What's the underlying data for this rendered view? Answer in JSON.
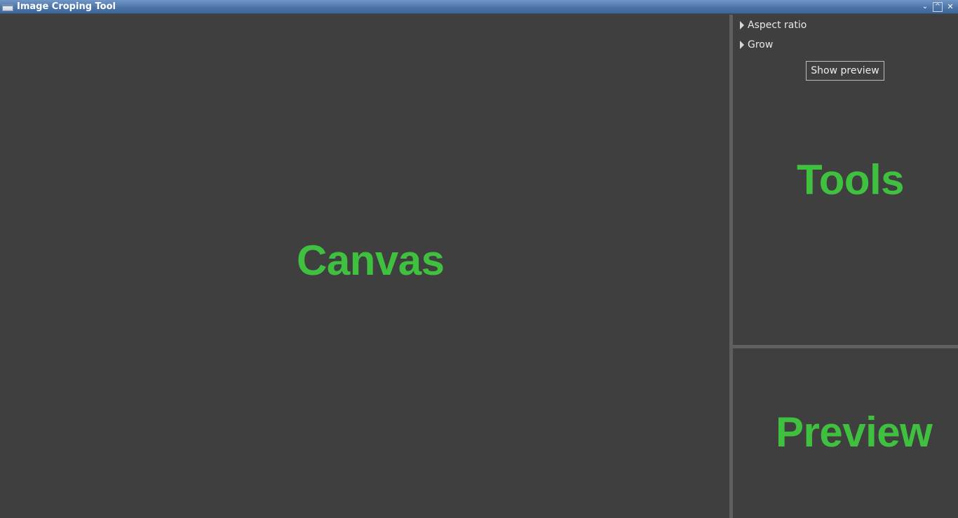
{
  "window": {
    "title": "Image Croping Tool",
    "controls": {
      "minimize_icon": "chevron-down-icon",
      "maximize_icon": "chevron-up-icon",
      "close_icon": "close-icon",
      "minimize_glyph": "⌄",
      "maximize_glyph": "^",
      "close_glyph": "✕"
    }
  },
  "canvas": {
    "label": "Canvas"
  },
  "tools": {
    "label": "Tools",
    "tree_items": [
      {
        "label": "Aspect ratio",
        "expanded": false
      },
      {
        "label": "Grow",
        "expanded": false
      }
    ],
    "show_preview_label": "Show preview"
  },
  "preview": {
    "label": "Preview"
  },
  "colors": {
    "background": "#3f3f3f",
    "divider": "#5f5f5f",
    "label_green": "#3fc13f",
    "titlebar": "#4d75a8"
  }
}
